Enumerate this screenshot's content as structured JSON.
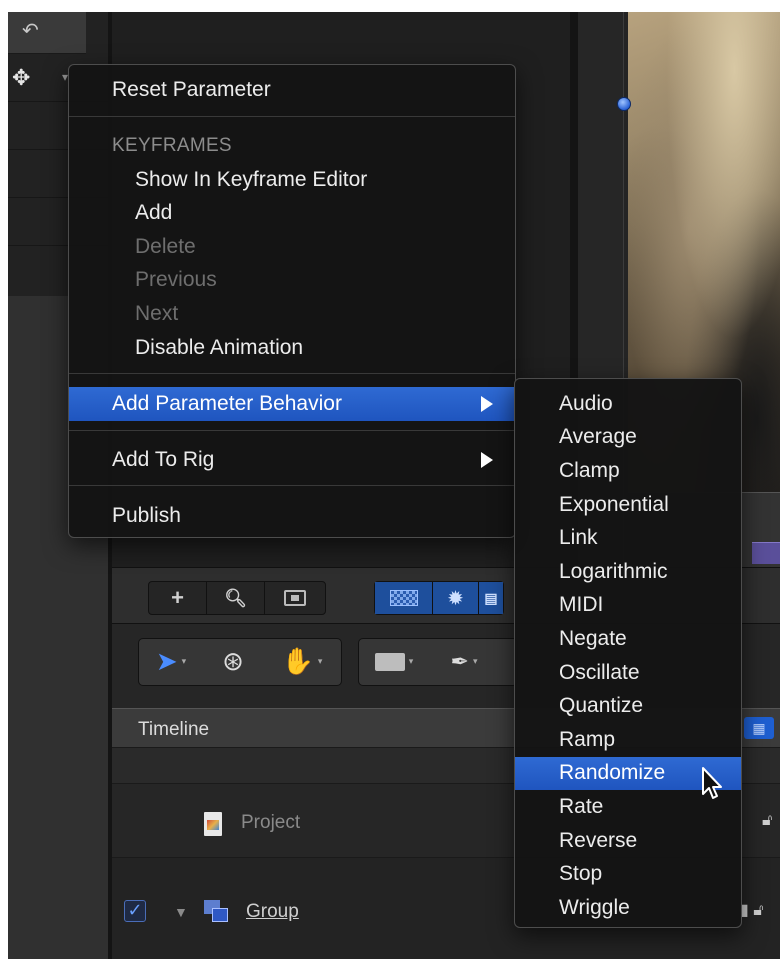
{
  "timeline": {
    "header_label": "Timeline",
    "rows": {
      "project_label": "Project",
      "group_label": "Group"
    }
  },
  "context_menu": {
    "reset_parameter": "Reset Parameter",
    "keyframes_header": "KEYFRAMES",
    "show_in_keyframe_editor": "Show In Keyframe Editor",
    "add": "Add",
    "delete": "Delete",
    "previous": "Previous",
    "next": "Next",
    "disable_animation": "Disable Animation",
    "add_parameter_behavior": "Add Parameter Behavior",
    "add_to_rig": "Add To Rig",
    "publish": "Publish"
  },
  "behavior_submenu": {
    "items": [
      "Audio",
      "Average",
      "Clamp",
      "Exponential",
      "Link",
      "Logarithmic",
      "MIDI",
      "Negate",
      "Oscillate",
      "Quantize",
      "Ramp",
      "Randomize",
      "Rate",
      "Reverse",
      "Stop",
      "Wriggle"
    ],
    "highlighted": "Randomize"
  },
  "colors": {
    "highlight": "#2563cc",
    "menu_bg": "#141414",
    "keyframe_dot": "#3b74e0"
  },
  "icons": {
    "toolbar1": [
      "plus-icon",
      "search-icon",
      "media-icon",
      "checker-icon",
      "gear-icon",
      "film-icon"
    ],
    "toolbar2": [
      "select-arrow-icon",
      "orbit-icon",
      "hand-icon",
      "rectangle-icon",
      "pen-icon"
    ]
  }
}
